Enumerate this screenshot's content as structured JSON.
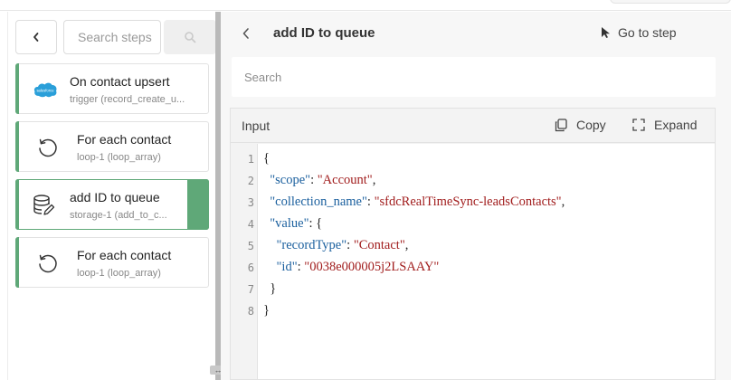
{
  "sidebar": {
    "search_placeholder": "Search steps",
    "steps": [
      {
        "title": "On contact upsert",
        "subtitle": "trigger (record_create_u...",
        "icon": "salesforce-icon"
      },
      {
        "title": "For each contact",
        "subtitle": "loop-1 (loop_array)",
        "icon": "loop-icon"
      },
      {
        "title": "add ID to queue",
        "subtitle": "storage-1 (add_to_c...",
        "icon": "storage-icon"
      },
      {
        "title": "For each contact",
        "subtitle": "loop-1 (loop_array)",
        "icon": "loop-icon"
      }
    ],
    "salesforce_logo_text": "salesforce"
  },
  "detail": {
    "title": "add ID to queue",
    "goto_label": "Go to step",
    "search_placeholder": "Search",
    "input": {
      "label": "Input",
      "copy_label": "Copy",
      "expand_label": "Expand",
      "line_numbers": [
        "1",
        "2",
        "3",
        "4",
        "5",
        "6",
        "7",
        "8"
      ],
      "json": {
        "scope_key": "\"scope\"",
        "scope_value": "\"Account\"",
        "collection_key": "\"collection_name\"",
        "collection_value": "\"sfdcRealTimeSync-leadsContacts\"",
        "value_key": "\"value\"",
        "record_type_key": "\"recordType\"",
        "record_type_value": "\"Contact\"",
        "id_key": "\"id\"",
        "id_value": "\"0038e000005j2LSAAY\""
      }
    }
  },
  "colors": {
    "accent_green": "#5fa878",
    "json_key": "#1a5f9e",
    "json_string": "#a11d1d"
  }
}
